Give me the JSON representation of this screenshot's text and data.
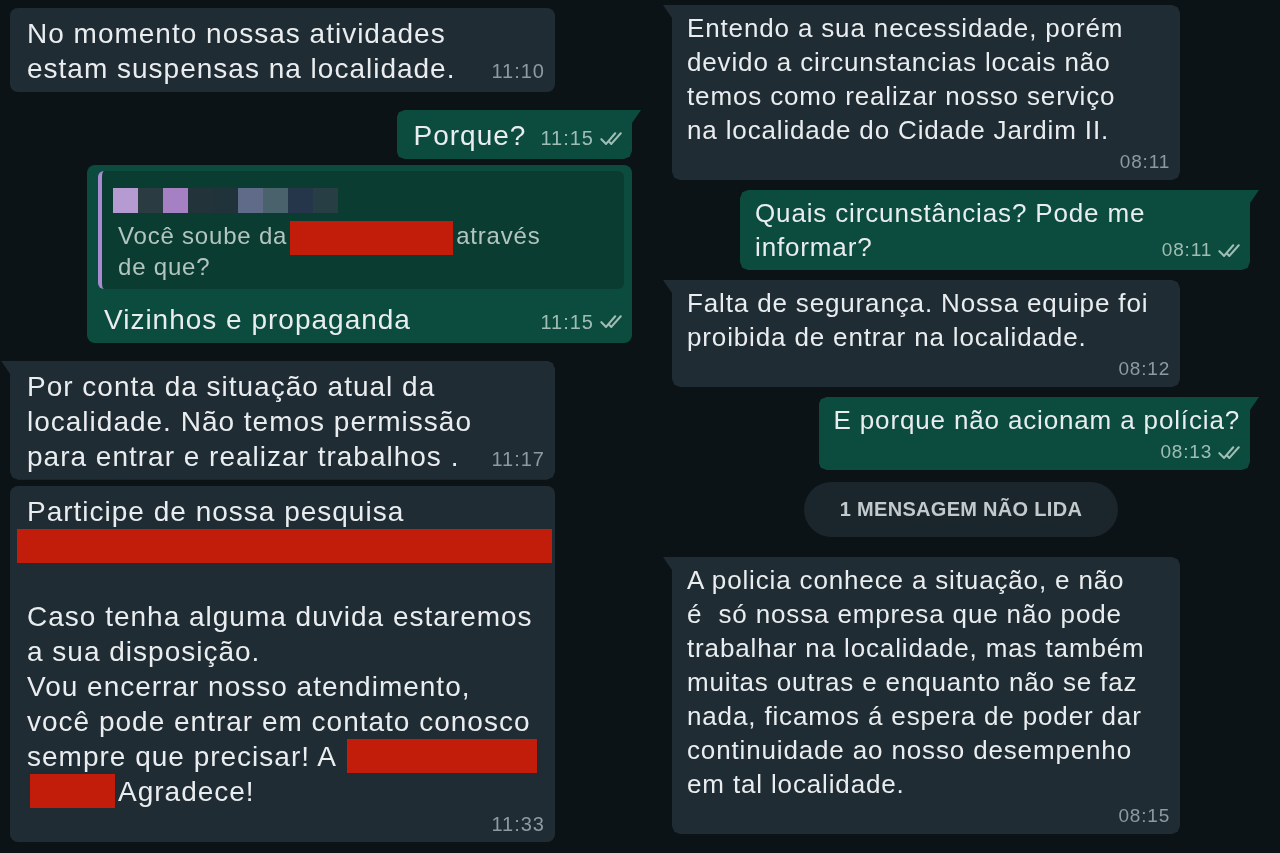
{
  "panels": [
    {
      "messages": [
        {
          "kind": "incoming",
          "tail": false,
          "segments": [
            {
              "kind": "text",
              "text": "No momento nossas atividades\nestam suspensas na localidade."
            }
          ],
          "time": "11:10"
        },
        {
          "kind": "outgoing",
          "tail": true,
          "segments": [
            {
              "kind": "text",
              "text": "Porque?"
            }
          ],
          "time": "11:15",
          "delivered": true,
          "read": false
        },
        {
          "kind": "outgoing",
          "tail": false,
          "quote": {
            "author": {
              "kind": "pixelated"
            },
            "segments": [
              {
                "kind": "text",
                "text": "Você soube da"
              },
              {
                "kind": "redaction"
              },
              {
                "kind": "text",
                "text": "através\nde que?"
              }
            ]
          },
          "segments": [
            {
              "kind": "text",
              "text": "Vizinhos e propaganda"
            }
          ],
          "time": "11:15",
          "delivered": true,
          "read": false
        },
        {
          "kind": "incoming",
          "tail": true,
          "segments": [
            {
              "kind": "text",
              "text": "Por conta da situação atual da\nlocalidade. Não temos permissão\npara entrar e realizar trabalhos ."
            }
          ],
          "time": "11:17"
        },
        {
          "kind": "incoming",
          "tail": false,
          "segments": [
            {
              "kind": "text",
              "text": "Participe de nossa pesquisa"
            },
            {
              "kind": "redaction_line"
            },
            {
              "kind": "text",
              "text": "\n\nCaso tenha alguma duvida estaremos\na sua disposição.\nVou encerrar nosso atendimento,\nvocê pode entrar em contato conosco\nsempre que precisar! A "
            },
            {
              "kind": "redaction"
            },
            {
              "kind": "redaction"
            },
            {
              "kind": "text",
              "text": "Agradece!"
            }
          ],
          "time": "11:33"
        }
      ]
    },
    {
      "messages": [
        {
          "kind": "incoming",
          "tail": true,
          "segments": [
            {
              "kind": "text",
              "text": "Entendo a sua necessidade, porém\ndevido a circunstancias locais não\ntemos como realizar nosso serviço\nna localidade do Cidade Jardim II."
            }
          ],
          "time": "08:11"
        },
        {
          "kind": "outgoing",
          "tail": true,
          "segments": [
            {
              "kind": "text",
              "text": "Quais circunstâncias? Pode me\ninformar?"
            }
          ],
          "time": "08:11",
          "delivered": true,
          "read": false
        },
        {
          "kind": "incoming",
          "tail": true,
          "segments": [
            {
              "kind": "text",
              "text": "Falta de segurança. Nossa equipe foi\nproibida de entrar na localidade."
            }
          ],
          "time": "08:12"
        },
        {
          "kind": "outgoing",
          "tail": true,
          "segments": [
            {
              "kind": "text",
              "text": "E porque não acionam a polícia?"
            }
          ],
          "time": "08:13",
          "delivered": true,
          "read": false
        },
        {
          "kind": "unread_divider",
          "text": "1 MENSAGEM NÃO LIDA"
        },
        {
          "kind": "incoming",
          "tail": true,
          "segments": [
            {
              "kind": "text",
              "text": "A policia conhece a situação, e não\né  só nossa empresa que não pode\ntrabalhar na localidade, mas também\nmuitas outras e enquanto não se faz\nnada, ficamos á espera de poder dar\ncontinuidade ao nosso desempenho\nem tal localidade."
            }
          ],
          "time": "08:15"
        }
      ]
    }
  ]
}
